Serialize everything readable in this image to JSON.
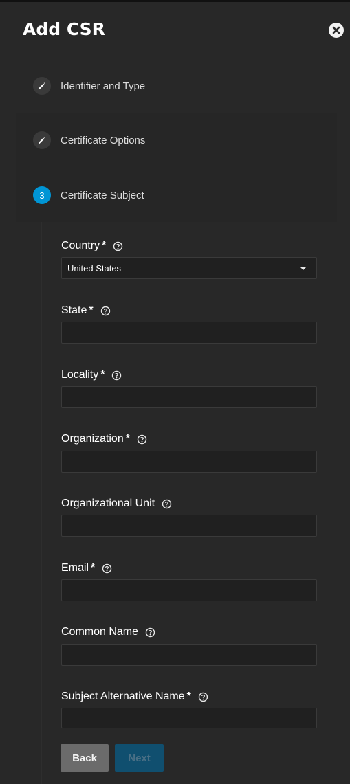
{
  "dialog": {
    "title": "Add CSR"
  },
  "steps": [
    {
      "label": "Identifier and Type",
      "icon": "pencil-icon",
      "state": "done"
    },
    {
      "label": "Certificate Options",
      "icon": "pencil-icon",
      "state": "done"
    },
    {
      "label": "Certificate Subject",
      "number": "3",
      "state": "active"
    }
  ],
  "fields": {
    "country": {
      "label": "Country",
      "required": "*",
      "value": "United States"
    },
    "state": {
      "label": "State",
      "required": "*",
      "value": ""
    },
    "locality": {
      "label": "Locality",
      "required": "*",
      "value": ""
    },
    "organization": {
      "label": "Organization",
      "required": "*",
      "value": ""
    },
    "org_unit": {
      "label": "Organizational Unit",
      "value": ""
    },
    "email": {
      "label": "Email",
      "required": "*",
      "value": ""
    },
    "common_name": {
      "label": "Common Name",
      "value": ""
    },
    "san": {
      "label": "Subject Alternative Name",
      "required": "*",
      "value": ""
    }
  },
  "buttons": {
    "back": "Back",
    "next": "Next"
  },
  "colors": {
    "accent": "#0095d5",
    "background": "#282828",
    "input_bg": "#202020"
  }
}
